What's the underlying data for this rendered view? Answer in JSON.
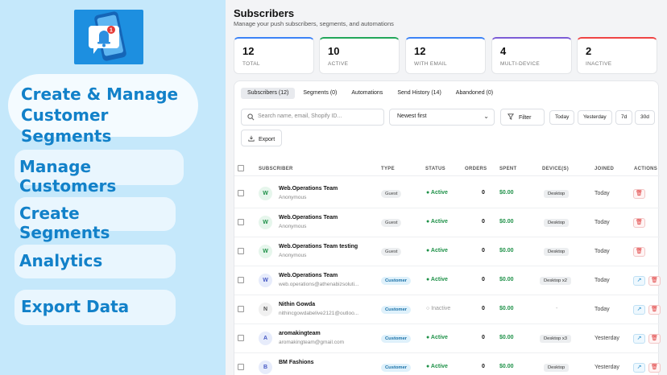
{
  "promo": {
    "headline_line1": "Create & Manage",
    "headline_line2": "Customer Segments",
    "features": [
      "Manage Customers",
      "Create Segments",
      "Analytics",
      "Export Data"
    ],
    "logo_badge": "1"
  },
  "page": {
    "title": "Subscribers",
    "subtitle": "Manage your push subscribers, segments, and automations"
  },
  "stats": [
    {
      "value": "12",
      "label": "TOTAL",
      "color": "#3b82f6"
    },
    {
      "value": "10",
      "label": "ACTIVE",
      "color": "#22a65a"
    },
    {
      "value": "12",
      "label": "WITH EMAIL",
      "color": "#3b82f6"
    },
    {
      "value": "4",
      "label": "MULTI-DEVICE",
      "color": "#7c5cd6"
    },
    {
      "value": "2",
      "label": "INACTIVE",
      "color": "#ef4444"
    }
  ],
  "tabs": [
    "Subscribers (12)",
    "Segments (0)",
    "Automations",
    "Send History (14)",
    "Abandoned (0)"
  ],
  "toolbar": {
    "search_placeholder": "Search name, email, Shopify ID...",
    "sort_value": "Newest first",
    "filter_label": "Filter",
    "ranges": [
      "Today",
      "Yesterday",
      "7d",
      "30d"
    ],
    "export_label": "Export"
  },
  "columns": {
    "subscriber": "SUBSCRIBER",
    "type": "TYPE",
    "status": "STATUS",
    "orders": "ORDERS",
    "spent": "SPENT",
    "devices": "DEVICE(S)",
    "joined": "JOINED",
    "actions": "ACTIONS"
  },
  "rows": [
    {
      "initial": "W",
      "name": "Web.Operations Team",
      "sub": "Anonymous",
      "type": "Guest",
      "status": "Active",
      "orders": "0",
      "spent": "$0.00",
      "device": "Desktop",
      "joined": "Today"
    },
    {
      "initial": "W",
      "name": "Web.Operations Team",
      "sub": "Anonymous",
      "type": "Guest",
      "status": "Active",
      "orders": "0",
      "spent": "$0.00",
      "device": "Desktop",
      "joined": "Today"
    },
    {
      "initial": "W",
      "name": "Web.Operations Team testing",
      "sub": "Anonymous",
      "type": "Guest",
      "status": "Active",
      "orders": "0",
      "spent": "$0.00",
      "device": "Desktop",
      "joined": "Today"
    },
    {
      "initial": "W",
      "name": "Web.Operations Team",
      "sub": "web.operations@athenabizsoluti...",
      "type": "Customer",
      "status": "Active",
      "orders": "0",
      "spent": "$0.00",
      "device": "Desktop x2",
      "joined": "Today"
    },
    {
      "initial": "N",
      "name": "Nithin Gowda",
      "sub": "nithincgowdabelive2121@outloo...",
      "type": "Customer",
      "status": "Inactive",
      "orders": "0",
      "spent": "$0.00",
      "device": "-",
      "joined": "Today"
    },
    {
      "initial": "A",
      "name": "aromakingteam",
      "sub": "aromakingteam@gmail.com",
      "type": "Customer",
      "status": "Active",
      "orders": "0",
      "spent": "$0.00",
      "device": "Desktop x3",
      "joined": "Yesterday"
    },
    {
      "initial": "B",
      "name": "BM Fashions",
      "sub": "",
      "type": "Customer",
      "status": "Active",
      "orders": "0",
      "spent": "$0.00",
      "device": "Desktop",
      "joined": "Yesterday"
    }
  ]
}
